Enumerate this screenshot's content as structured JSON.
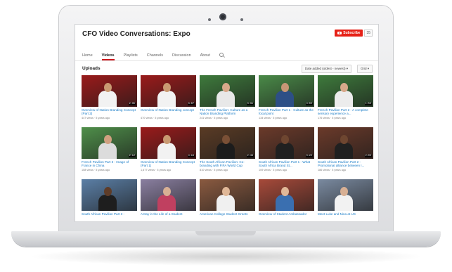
{
  "channel": {
    "title": "CFO Video Conversations: Expo",
    "subscribe_label": "Subscribe",
    "subscriber_count": "35"
  },
  "tabs": [
    {
      "label": "Home"
    },
    {
      "label": "Videos",
      "active": true
    },
    {
      "label": "Playlists"
    },
    {
      "label": "Channels"
    },
    {
      "label": "Discussion"
    },
    {
      "label": "About"
    }
  ],
  "uploads": {
    "title": "Uploads",
    "sort_label": "Date added (oldest - newest) ▾",
    "grid_label": "Grid ▾"
  },
  "videos": [
    {
      "title": "Overview of Nation Branding Concept (Part 2)",
      "meta": "447 views · 5 years ago",
      "duration": "2:35",
      "bg": "#9a1b1b",
      "shirt": "#f2f2f2",
      "skin": "#c99a72"
    },
    {
      "title": "Overview of Nation Branding concept",
      "meta": "470 views · 5 years ago",
      "duration": "3:07",
      "bg": "#9a1b1b",
      "shirt": "#f2f2f2",
      "skin": "#c99a72"
    },
    {
      "title": "The French Pavilion: Culture as a Nation Branding Platform",
      "meta": "241 views · 5 years ago",
      "duration": "3:31",
      "bg": "#3e7a3c",
      "shirt": "#e8e8e8",
      "skin": "#d8a88a"
    },
    {
      "title": "French Pavilion Part 1 - Culture as the focal point",
      "meta": "134 views · 5 years ago",
      "duration": "4:02",
      "bg": "#4a8a48",
      "shirt": "#2d4f86",
      "skin": "#c89676"
    },
    {
      "title": "French Pavilion Part 2 - A complete sensory experience a...",
      "meta": "176 views · 5 years ago",
      "duration": "1:55",
      "bg": "#3e7a3c",
      "shirt": "#ececec",
      "skin": "#d8a88a"
    },
    {
      "title": "French Pavilion Part 3 - Image of France in China",
      "meta": "158 views · 5 years ago",
      "duration": "2:12",
      "bg": "#4f8f4a",
      "shirt": "#dcdcdc",
      "skin": "#d0a080"
    },
    {
      "title": "Overview of Nation Branding Concept (Part 1)",
      "meta": "1,677 views · 5 years ago",
      "duration": "4:19",
      "bg": "#9a1b1b",
      "shirt": "#f2f2f2",
      "skin": "#c99a72"
    },
    {
      "title": "The South African Pavilion: Co-branding with FIFA World Cup",
      "meta": "810 views · 5 years ago",
      "duration": "2:48",
      "bg": "#5a3b25",
      "shirt": "#1c1c1c",
      "skin": "#7a5036"
    },
    {
      "title": "South African Pavilion Part 1 - What South Africa Brand St...",
      "meta": "109 views · 5 years ago",
      "duration": "3:22",
      "bg": "#6b3a2a",
      "shirt": "#202020",
      "skin": "#6e4630"
    },
    {
      "title": "South African Pavilion Part 2 - Promotional alliance between I...",
      "meta": "186 views · 5 years ago",
      "duration": "2:05",
      "bg": "#6b3a2a",
      "shirt": "#202020",
      "skin": "#6e4630"
    },
    {
      "title": "South African Pavilion Part 3 -",
      "meta": "",
      "duration": "",
      "bg": "#5b7fa6",
      "shirt": "#1e1e1e",
      "skin": "#5e3c28"
    },
    {
      "title": "A Day in the Life of a Student",
      "meta": "",
      "duration": "",
      "bg": "#8a7fa0",
      "shirt": "#c04060",
      "skin": "#d8b094"
    },
    {
      "title": "American College Student Greets",
      "meta": "",
      "duration": "",
      "bg": "#8a5a40",
      "shirt": "#f0f0f0",
      "skin": "#e0b898"
    },
    {
      "title": "Overview of Student Ambassador",
      "meta": "",
      "duration": "",
      "bg": "#a74a3a",
      "shirt": "#3a6fb0",
      "skin": "#e0b898"
    },
    {
      "title": "Meet Luke and Nina at US",
      "meta": "",
      "duration": "",
      "bg": "#7a8aa0",
      "shirt": "#f2f2f2",
      "skin": "#d8b094"
    }
  ]
}
